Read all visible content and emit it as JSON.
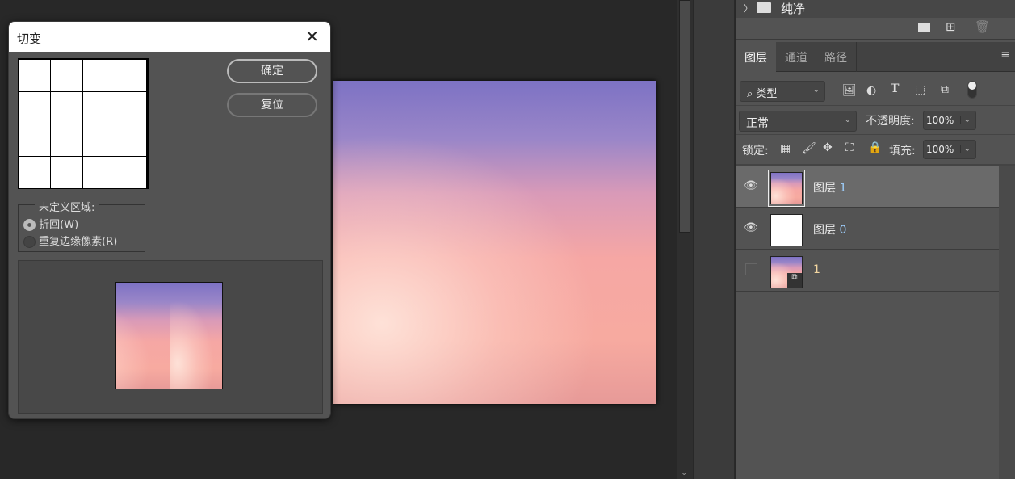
{
  "dialog": {
    "title": "切变",
    "ok": "确定",
    "reset": "复位",
    "undefined_area_label": "未定义区域:",
    "options": [
      {
        "label": "折回(W)",
        "selected": true
      },
      {
        "label": "重复边缘像素(R)",
        "selected": false
      }
    ]
  },
  "panel": {
    "group_name": "纯净",
    "tabs": [
      "图层",
      "通道",
      "路径"
    ],
    "active_tab": "图层",
    "filter_label": "类型",
    "blend_mode": "正常",
    "opacity_label": "不透明度:",
    "opacity": "100%",
    "lock_label": "锁定:",
    "fill_label": "填充:",
    "fill": "100%",
    "layers": [
      {
        "prefix": "图层",
        "num": "1",
        "visible": true,
        "selected": true,
        "thumb": "sky"
      },
      {
        "prefix": "图层",
        "num": "0",
        "visible": true,
        "selected": false,
        "thumb": "white"
      },
      {
        "prefix": "",
        "num": "1",
        "visible": false,
        "selected": false,
        "thumb": "sky-smart"
      }
    ]
  }
}
